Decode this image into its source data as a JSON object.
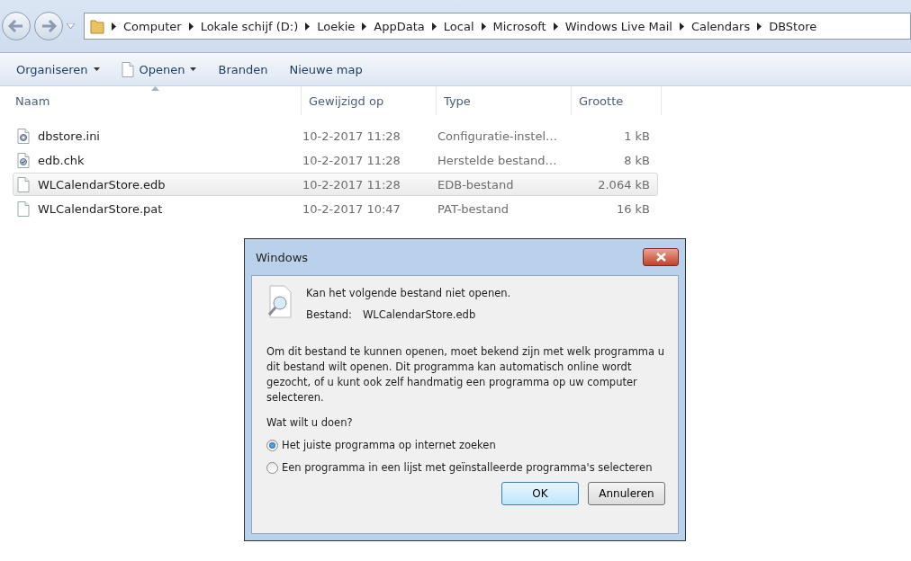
{
  "breadcrumb": [
    "Computer",
    "Lokale schijf (D:)",
    "Loekie",
    "AppData",
    "Local",
    "Microsoft",
    "Windows Live Mail",
    "Calendars",
    "DBStore"
  ],
  "toolbar": [
    {
      "label": "Organiseren",
      "dropdown": true,
      "kind": "menu"
    },
    {
      "label": "Openen",
      "dropdown": true,
      "kind": "open"
    },
    {
      "label": "Branden",
      "dropdown": false,
      "kind": "plain"
    },
    {
      "label": "Nieuwe map",
      "dropdown": false,
      "kind": "plain"
    }
  ],
  "columns": [
    "Naam",
    "Gewijzigd op",
    "Type",
    "Grootte"
  ],
  "files": [
    {
      "name": "dbstore.ini",
      "modified": "10-2-2017 11:28",
      "type": "Configuratie-instel…",
      "size": "1 kB",
      "kind": "settings",
      "selected": false
    },
    {
      "name": "edb.chk",
      "modified": "10-2-2017 11:28",
      "type": "Herstelde bestand…",
      "size": "8 kB",
      "kind": "checked",
      "selected": false
    },
    {
      "name": "WLCalendarStore.edb",
      "modified": "10-2-2017 11:28",
      "type": "EDB-bestand",
      "size": "2.064 kB",
      "kind": "blank",
      "selected": true
    },
    {
      "name": "WLCalendarStore.pat",
      "modified": "10-2-2017 10:47",
      "type": "PAT-bestand",
      "size": "16 kB",
      "kind": "blank",
      "selected": false
    }
  ],
  "dialog": {
    "title": "Windows",
    "heading": "Kan het volgende bestand niet openen.",
    "file_label": "Bestand:",
    "file_name": "WLCalendarStore.edb",
    "description": "Om dit bestand te kunnen openen, moet bekend zijn met welk programma u dit bestand wilt openen. Dit programma kan automatisch online wordt gezocht, of u kunt ook zelf handmatig een programma op uw computer selecteren.",
    "question": "Wat wilt u doen?",
    "options": [
      {
        "label": "Het juiste programma op internet zoeken",
        "selected": true
      },
      {
        "label": "Een programma in een lijst met geïnstalleerde programma's selecteren",
        "selected": false
      }
    ],
    "buttons": [
      {
        "label": "OK",
        "default": true
      },
      {
        "label": "Annuleren",
        "default": false
      }
    ]
  }
}
